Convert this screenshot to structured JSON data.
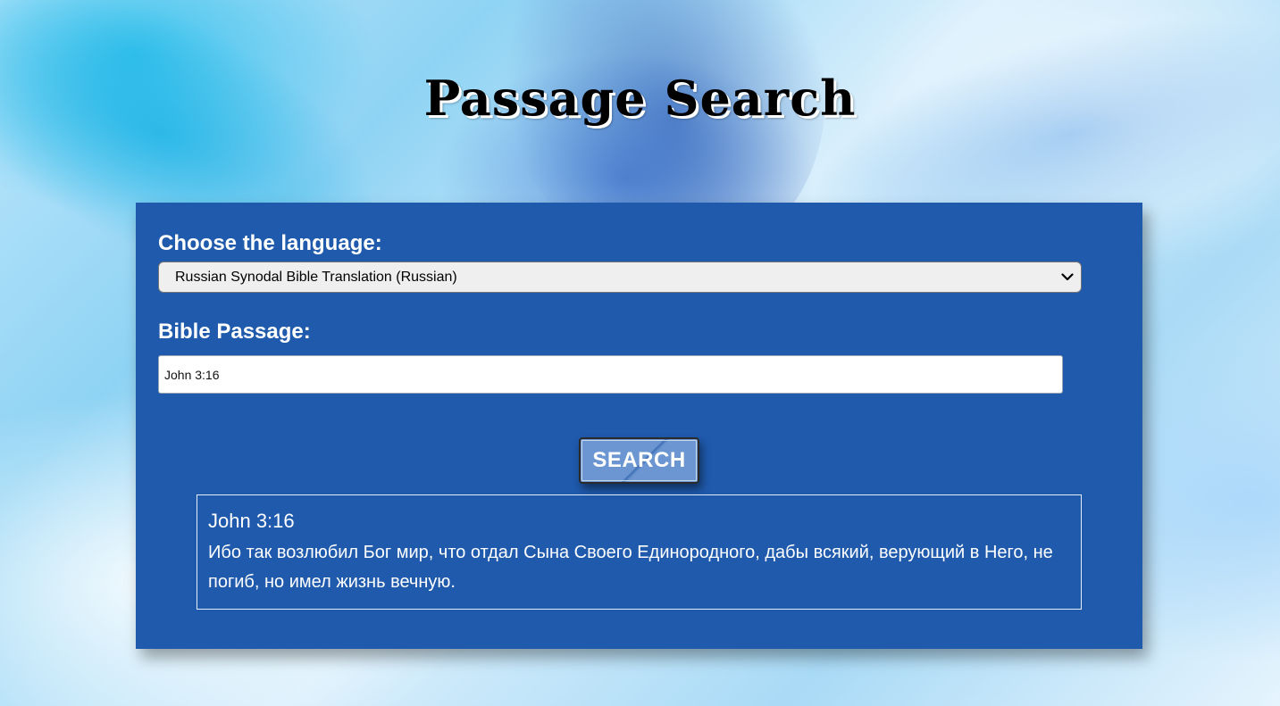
{
  "page": {
    "title": "Passage Search"
  },
  "form": {
    "language_label": "Choose the language:",
    "language_selected": "Russian Synodal Bible Translation (Russian)",
    "passage_label": "Bible Passage:",
    "passage_value": "John 3:16",
    "search_label": "SEARCH"
  },
  "result": {
    "reference": "John 3:16",
    "text": "Ибо так возлюбил Бог мир, что отдал Сына Своего Единородного, дабы всякий, верующий в Него, не погиб, но имел жизнь вечную."
  },
  "icons": {
    "select_chevron": "chevron-down-icon"
  },
  "colors": {
    "panel": "#1f5aad",
    "button": "#6b96d1",
    "text_on_panel": "#ffffff"
  }
}
